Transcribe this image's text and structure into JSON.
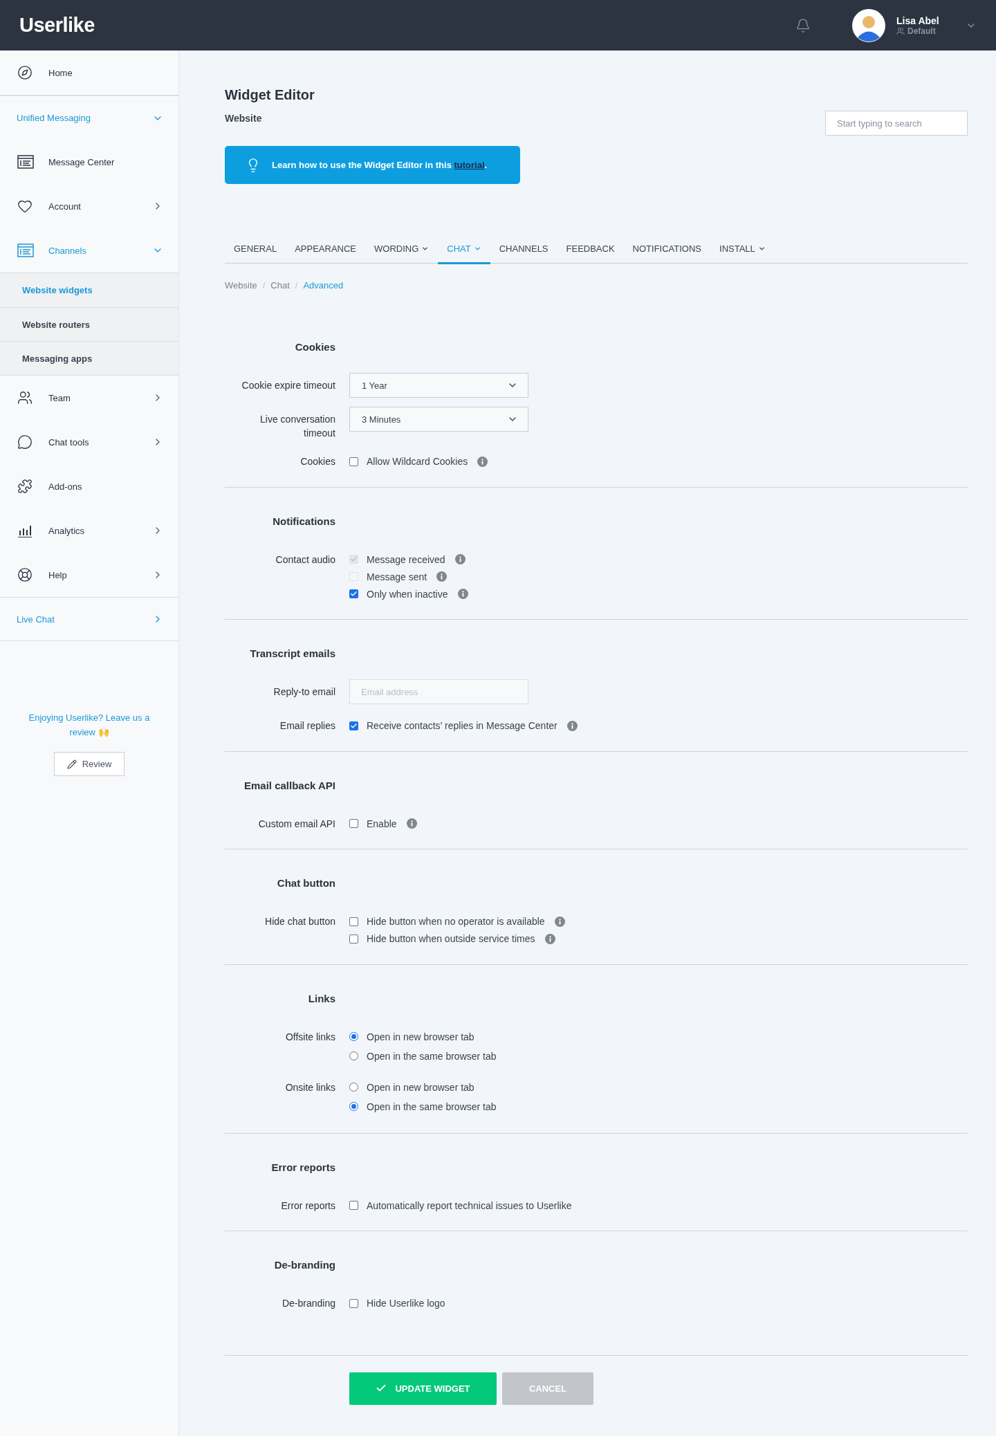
{
  "header": {
    "logo": "Userlike",
    "user": {
      "name": "Lisa Abel",
      "role": "Default"
    }
  },
  "sidebar": {
    "items": [
      {
        "kind": "link",
        "label": "Home",
        "selected": false
      },
      {
        "kind": "group",
        "label": "Unified Messaging",
        "expanded": true
      },
      {
        "kind": "link",
        "label": "Message Center",
        "selected": false
      },
      {
        "kind": "link",
        "label": "Account",
        "selected": false,
        "expanded": false
      },
      {
        "kind": "link",
        "label": "Channels",
        "selected": true,
        "expanded": true,
        "children": [
          {
            "label": "Website widgets",
            "selected": true
          },
          {
            "label": "Website routers",
            "selected": false
          },
          {
            "label": "Messaging apps",
            "selected": false
          }
        ]
      },
      {
        "kind": "link",
        "label": "Team",
        "selected": false,
        "expanded": false
      },
      {
        "kind": "link",
        "label": "Chat tools",
        "selected": false,
        "expanded": false
      },
      {
        "kind": "link",
        "label": "Add-ons",
        "selected": false
      },
      {
        "kind": "link",
        "label": "Analytics",
        "selected": false,
        "expanded": false
      },
      {
        "kind": "link",
        "label": "Help",
        "selected": false,
        "expanded": false
      },
      {
        "kind": "group",
        "label": "Live Chat",
        "expanded": false
      }
    ],
    "review": {
      "text": "Enjoying Userlike? Leave us a review 🙌",
      "button": "Review"
    }
  },
  "page": {
    "title": "Widget Editor",
    "subtitle": "Website",
    "search": {
      "placeholder": "Start typing to search"
    },
    "banner": {
      "text": "Learn how to use the Widget Editor in this ",
      "link": "tutorial",
      "after": "."
    },
    "tabs": [
      {
        "label": "GENERAL",
        "selected": false,
        "dropdown": false
      },
      {
        "label": "APPEARANCE",
        "selected": false,
        "dropdown": false
      },
      {
        "label": "WORDING",
        "selected": false,
        "dropdown": true
      },
      {
        "label": "CHAT",
        "selected": true,
        "dropdown": true
      },
      {
        "label": "CHANNELS",
        "selected": false,
        "dropdown": false
      },
      {
        "label": "FEEDBACK",
        "selected": false,
        "dropdown": false
      },
      {
        "label": "NOTIFICATIONS",
        "selected": false,
        "dropdown": false
      },
      {
        "label": "INSTALL",
        "selected": false,
        "dropdown": true
      }
    ],
    "breadcrumb": [
      {
        "label": "Website",
        "selected": false
      },
      {
        "separator": "/",
        "label": "Chat",
        "selected": false
      },
      {
        "separator": "/",
        "label": "Advanced",
        "selected": true
      }
    ]
  },
  "sections": [
    {
      "heading": "Cookies",
      "rows": [
        {
          "label": "Cookie expire timeout",
          "kind": "select",
          "value": "1 Year"
        },
        {
          "label": "Live conversation timeout",
          "kind": "select",
          "value": "3 Minutes"
        },
        {
          "label": "Cookies",
          "kind": "checkboxes",
          "options": [
            {
              "label": "Allow Wildcard Cookies",
              "checked": false,
              "disabled": false,
              "info": true
            }
          ]
        }
      ]
    },
    {
      "heading": "Notifications",
      "rows": [
        {
          "label": "Contact audio",
          "kind": "checkboxes",
          "options": [
            {
              "label": "Message received",
              "checked": true,
              "disabled": true,
              "info": true
            },
            {
              "label": "Message sent",
              "checked": false,
              "disabled": true,
              "info": true
            },
            {
              "label": "Only when inactive",
              "checked": true,
              "disabled": false,
              "info": true
            }
          ]
        }
      ]
    },
    {
      "heading": "Transcript emails",
      "rows": [
        {
          "label": "Reply-to email",
          "kind": "input",
          "placeholder": "Email address"
        },
        {
          "label": "Email replies",
          "kind": "checkboxes",
          "options": [
            {
              "label": "Receive contacts’ replies in Message Center",
              "checked": true,
              "disabled": false,
              "info": true
            }
          ]
        }
      ]
    },
    {
      "heading": "Email callback API",
      "rows": [
        {
          "label": "Custom email API",
          "kind": "checkboxes",
          "options": [
            {
              "label": "Enable",
              "checked": false,
              "disabled": false,
              "info": true
            }
          ]
        }
      ]
    },
    {
      "heading": "Chat button",
      "rows": [
        {
          "label": "Hide chat button",
          "kind": "checkboxes",
          "options": [
            {
              "label": "Hide button when no operator is available",
              "checked": false,
              "disabled": false,
              "info": true
            },
            {
              "label": "Hide button when outside service times",
              "checked": false,
              "disabled": false,
              "info": true
            }
          ]
        }
      ]
    },
    {
      "heading": "Links",
      "rows": [
        {
          "label": "Offsite links",
          "kind": "radios",
          "options": [
            {
              "label": "Open in new browser tab",
              "selected": true
            },
            {
              "label": "Open in the same browser tab",
              "selected": false
            }
          ]
        },
        {
          "label": "Onsite links",
          "kind": "radios",
          "options": [
            {
              "label": "Open in new browser tab",
              "selected": false
            },
            {
              "label": "Open in the same browser tab",
              "selected": true
            }
          ]
        }
      ]
    },
    {
      "heading": "Error reports",
      "rows": [
        {
          "label": "Error reports",
          "kind": "checkboxes",
          "options": [
            {
              "label": "Automatically report technical issues to Userlike",
              "checked": false,
              "disabled": false
            }
          ]
        }
      ]
    },
    {
      "heading": "De-branding",
      "rows": [
        {
          "label": "De-branding",
          "kind": "checkboxes",
          "options": [
            {
              "label": "Hide Userlike logo",
              "checked": false,
              "disabled": false
            }
          ]
        }
      ]
    }
  ],
  "actions": [
    {
      "label": "UPDATE WIDGET",
      "kind": "primary"
    },
    {
      "label": "CANCEL",
      "kind": "secondary"
    }
  ]
}
